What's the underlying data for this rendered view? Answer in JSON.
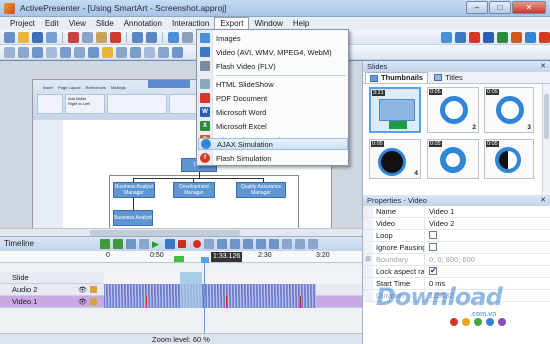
{
  "window": {
    "title": "ActivePresenter - [Using SmartArt - Screenshot.approj]",
    "min": "–",
    "max": "□",
    "close": "✕"
  },
  "menu": [
    "Project",
    "Edit",
    "View",
    "Slide",
    "Annotation",
    "Interaction",
    "Export",
    "Window",
    "Help"
  ],
  "menu_active": "Export",
  "export_menu": {
    "items": [
      {
        "label": "Images",
        "icon": "images-icon",
        "color": "#4a8fd8",
        "glyph": ""
      },
      {
        "label": "Video (AVI, WMV, MPEG4, WebM)",
        "icon": "video-icon",
        "color": "#3d78c4",
        "glyph": ""
      },
      {
        "label": "Flash Video (FLV)",
        "icon": "flash-video-icon",
        "color": "#7a8b9f",
        "glyph": ""
      },
      {
        "label": "HTML SlideShow",
        "icon": "html-icon",
        "color": "#8fa6c0",
        "glyph": ""
      },
      {
        "label": "PDF Document",
        "icon": "pdf-icon",
        "color": "#d8352a",
        "glyph": ""
      },
      {
        "label": "Microsoft Word",
        "icon": "word-icon",
        "color": "#2b5fb3",
        "glyph": "W"
      },
      {
        "label": "Microsoft Excel",
        "icon": "excel-icon",
        "color": "#2e8b3e",
        "glyph": "X"
      },
      {
        "label": "Microsoft PowerPoint",
        "icon": "powerpoint-icon",
        "color": "#d2571f",
        "glyph": "P"
      },
      {
        "label": "AJAX Simulation",
        "icon": "ajax-icon",
        "color": "#2f86d6",
        "glyph": ""
      },
      {
        "label": "Flash Simulation",
        "icon": "flash-simulation-icon",
        "color": "#d43a22",
        "glyph": "f"
      }
    ],
    "hover_index": 8
  },
  "slides_panel": {
    "title": "Slides",
    "tabs": [
      "Thumbnails",
      "Titles"
    ],
    "thumbs": [
      {
        "time": "3:21",
        "num": ""
      },
      {
        "time": "0:05",
        "num": "2"
      },
      {
        "time": "0:05",
        "num": "3"
      },
      {
        "time": "0:05",
        "num": "4"
      },
      {
        "time": "0:05",
        "num": ""
      },
      {
        "time": "0:05",
        "num": ""
      }
    ]
  },
  "properties": {
    "title": "Properties - Video",
    "rows": [
      {
        "name": "Name",
        "value": "Video 1"
      },
      {
        "name": "Video",
        "value": "Video 2"
      },
      {
        "name": "Loop",
        "value": ""
      },
      {
        "name": "Ignore Pausing",
        "value": ""
      },
      {
        "name": "Boundary",
        "value": "0; 0; 800; 600"
      },
      {
        "name": "Lock aspect rat",
        "value": ""
      },
      {
        "name": "Start Time",
        "value": "0 ms"
      },
      {
        "name": "Duration",
        "value": "110632"
      }
    ],
    "checkbox_states": {
      "loop": false,
      "ignore_pausing": false,
      "lock_aspect": true
    }
  },
  "org_chart": {
    "ceo": "CEO",
    "children": [
      "Business Analyst Manager",
      "Development Manager",
      "Quality Assurance Manager"
    ],
    "grandchild": "Business Analyst"
  },
  "inner_ribbon": {
    "tabs": [
      "Insert",
      "Page Layout",
      "References",
      "Mailings"
    ],
    "group_labels": [
      "Add Bullet",
      "Right to Left",
      "Layout"
    ],
    "blue_tab": "SmartArt"
  },
  "timeline": {
    "title": "Timeline",
    "ticks": [
      "0",
      "0:50",
      "1:33.126",
      "2:30",
      "3:20"
    ],
    "tracks": [
      "Slide",
      "Audio 2",
      "Video 1"
    ],
    "zoom_label": "Zoom level:",
    "zoom_value": "60 %"
  },
  "watermark": {
    "text": "Download",
    "sub": ".com.vn",
    "dot_colors": [
      "#d8352a",
      "#f0a21c",
      "#4aa33b",
      "#2f86d6",
      "#8a4bb8"
    ]
  }
}
